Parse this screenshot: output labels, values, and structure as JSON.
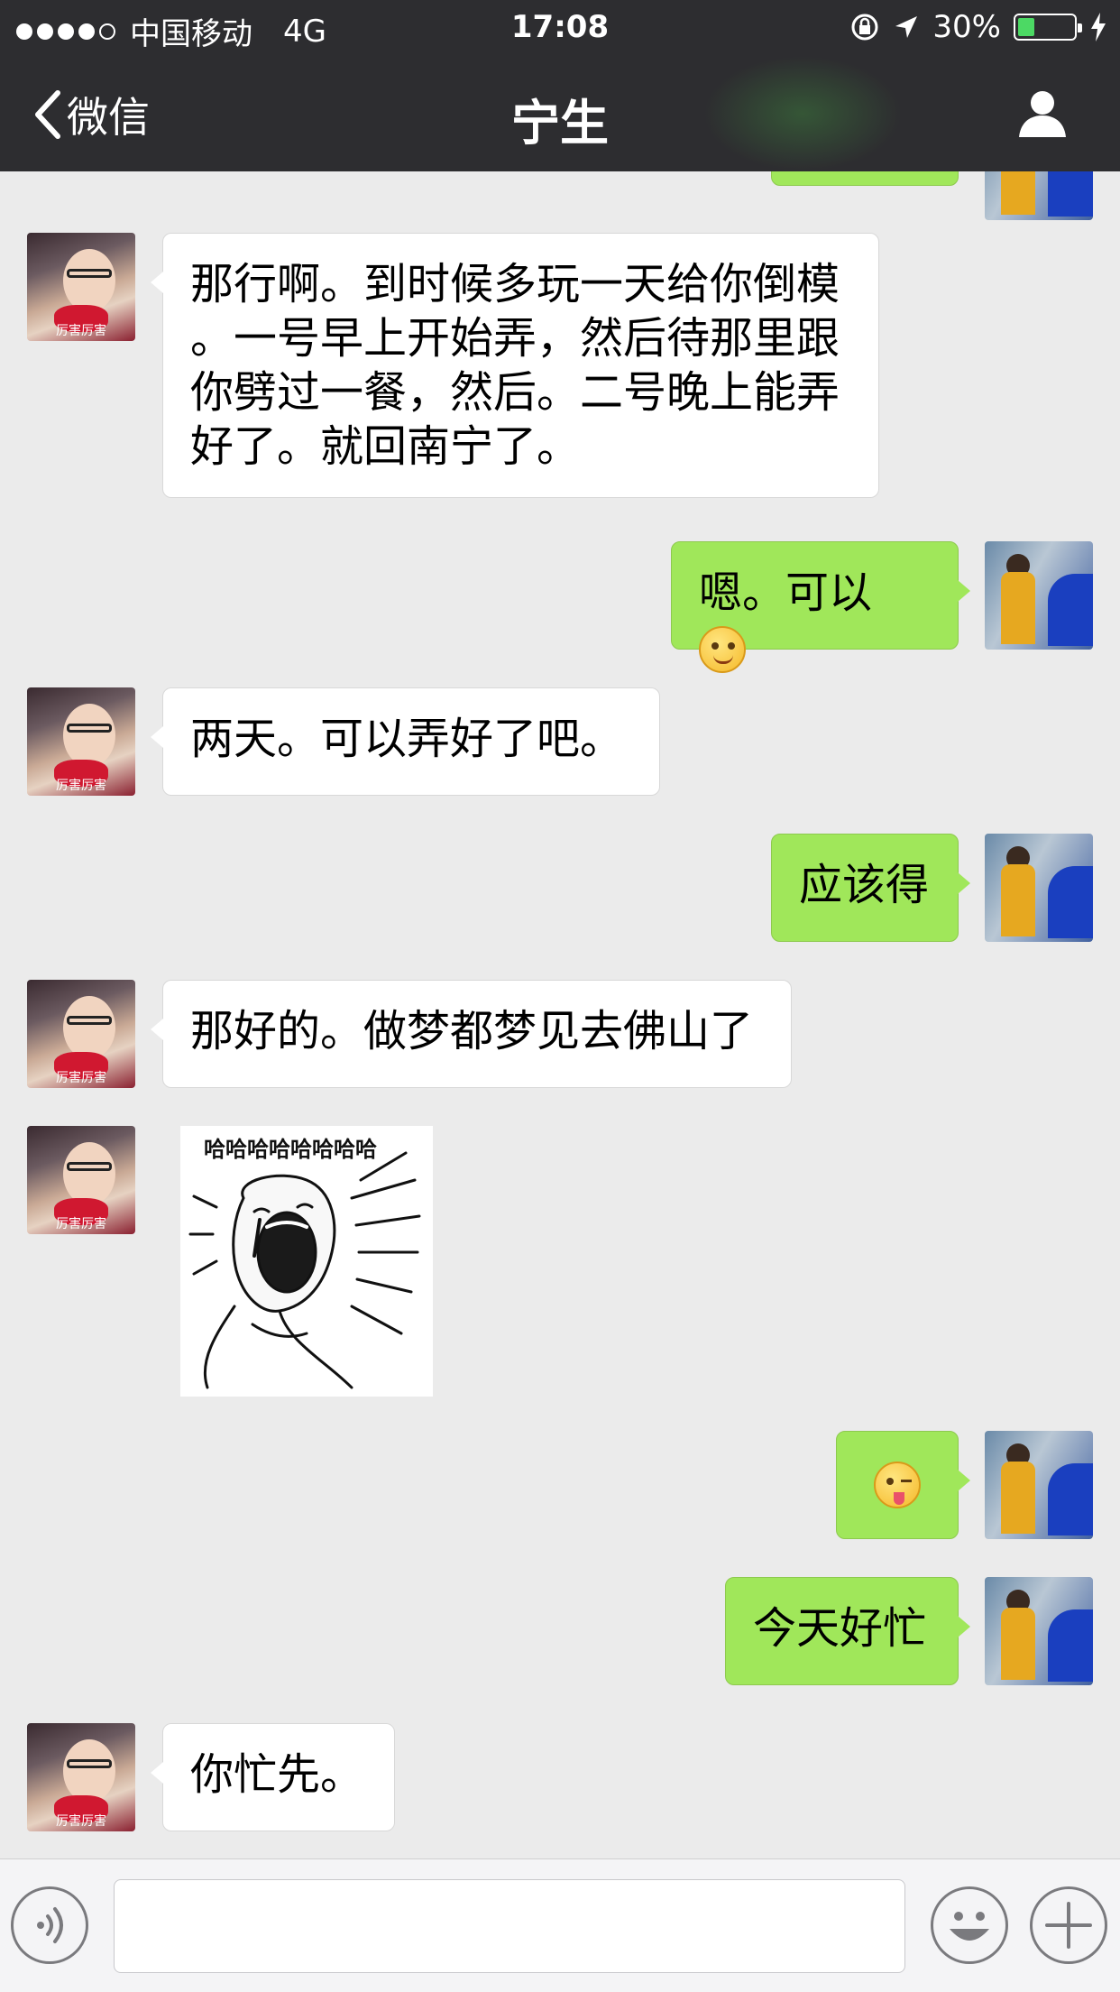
{
  "status_bar": {
    "carrier": "中国移动",
    "network": "4G",
    "time": "17:08",
    "battery": "30%",
    "battery_level": 0.3
  },
  "nav": {
    "back_label": "微信",
    "title": "宁生"
  },
  "messages": [
    {
      "from": "other",
      "text": "那行啊。到时候多玩一天给你倒模\n。一号早上开始弄，然后待那里跟\n你劈过一餐，然后。二号晚上能弄\n好了。就回南宁了。"
    },
    {
      "from": "me",
      "text": "嗯。可以",
      "emoji": "smile-emoji"
    },
    {
      "from": "other",
      "text": "两天。可以弄好了吧。"
    },
    {
      "from": "me",
      "text": "应该得"
    },
    {
      "from": "other",
      "text": "那好的。做梦都梦见去佛山了"
    },
    {
      "from": "other",
      "sticker_caption": "哈哈哈哈哈哈哈哈"
    },
    {
      "from": "me",
      "emoji": "wink-tongue-emoji"
    },
    {
      "from": "me",
      "text": "今天好忙"
    },
    {
      "from": "other",
      "text": "你忙先。"
    }
  ],
  "avatars": {
    "other_tag": "厉害厉害"
  },
  "colors": {
    "bar": "#2d2d30",
    "bubble_green": "#a0e75a",
    "chat_bg": "#ebebeb"
  }
}
